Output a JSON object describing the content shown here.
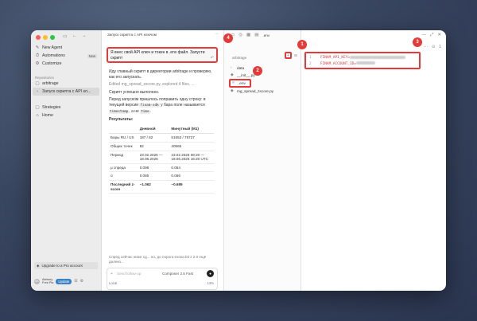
{
  "sidebar": {
    "items": [
      {
        "icon": "new-agent-icon",
        "label": "New Agent"
      },
      {
        "icon": "automations-icon",
        "label": "Automations",
        "badge": "New"
      },
      {
        "icon": "customize-icon",
        "label": "Customize"
      }
    ],
    "section_label": "Repositories",
    "repos": [
      {
        "label": "arbitrage"
      },
      {
        "label": "Запуск скрипта с API кл..."
      }
    ],
    "more": [
      {
        "label": "Strategies"
      },
      {
        "label": "Home"
      }
    ],
    "upgrade_label": "Upgrade to a Pro account",
    "account_name": "Aleksey",
    "account_plan": "Free Pla",
    "update_label": "Update"
  },
  "chat": {
    "title": "Запуск скрипта с API ключом",
    "prompt": "Я внес свой API ключ и токен в .env файл. Запусти скрипт",
    "msg1": "Иду главный скрипт в директории arbitrage и проверяю, как его запускать.",
    "msg2": "Edited mg_spread_zscore.py, explored 4 files, ...",
    "msg3": "Скрипт успешно выполнен.",
    "msg4_a": "Перед запуском пришлось поправить одну строку: в текущей версии",
    "msg4_code1": "finam-sdk",
    "msg4_b": "у бара поле называется",
    "msg4_code2": "timestamp",
    "msg4_c": ", а не",
    "msg4_code3": "time",
    "msg4_d": ".",
    "results_label": "Результаты:",
    "table": {
      "headers": [
        "",
        "Дневной",
        "Минутный (M1)"
      ],
      "rows": [
        [
          "Бары RU / US",
          "187 / 82",
          "51553 / 76727"
        ],
        [
          "Общих точек",
          "82",
          "40565"
        ],
        [
          "Период",
          "23.02.2026 — 18.06.2026",
          "23.02.2026 08:20 — 18.06.2026 16:20 UTC"
        ],
        [
          "μ спреда",
          "0.098",
          "0.054"
        ],
        [
          "σ",
          "0.085",
          "0.066"
        ],
        [
          "Последний z-score",
          "−1.062",
          "−0.689"
        ]
      ]
    },
    "fade_text": "Спред сейчас ниже сд... но, до порога exosa bit z 2.0 ещё далеко...",
    "composer_placeholder": "Send follow-up",
    "composer_model": "Composer 2.5 Fast",
    "local_label": "Local",
    "context_pct": "13%"
  },
  "files": {
    "tab_label": ".env",
    "root_label": "arbitrage",
    "tree": [
      {
        "icon": "chevron-right-icon",
        "label": "data"
      },
      {
        "icon": "python-file-icon",
        "label": "__init__.py"
      },
      {
        "icon": "env-file-icon",
        "label": ".env"
      },
      {
        "icon": "python-file-icon",
        "label": "mg_spread_zscore.py"
      }
    ]
  },
  "editor": {
    "lines": [
      {
        "num": "1",
        "key": "FINAM_API_KEY="
      },
      {
        "num": "2",
        "key": "FINAM_ACCOUNT_ID="
      }
    ],
    "tool_count": "1"
  },
  "callouts": [
    "1",
    "2",
    "3",
    "4"
  ],
  "colors": {
    "callout": "#e53a3a",
    "update": "#3b82c4"
  }
}
